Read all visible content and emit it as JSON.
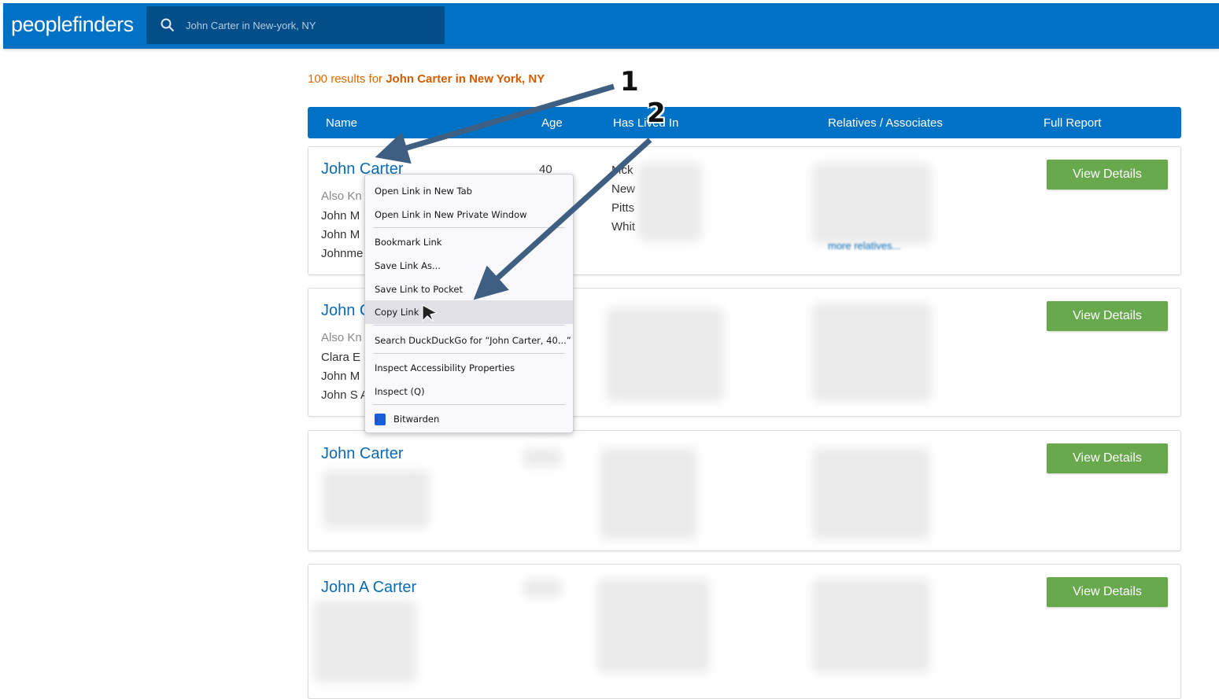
{
  "header": {
    "logo": "peoplefinders",
    "search_value": "John Carter in New-york, NY"
  },
  "summary": {
    "prefix": "100 results for ",
    "query": "John Carter in New York, NY"
  },
  "table_header": {
    "name": "Name",
    "age": "Age",
    "lived": "Has Lived In",
    "relatives": "Relatives / Associates",
    "report": "Full Report"
  },
  "results": [
    {
      "name": "John Carter",
      "age": "40",
      "aka_label": "Also Kn",
      "aka": [
        "John M",
        "John M",
        "Johnme"
      ],
      "places": [
        "Mck",
        "New",
        "Pitts",
        "Whit"
      ],
      "more_relatives": "more relatives...",
      "button": "View Details"
    },
    {
      "name": "John C",
      "aka_label": "Also Kn",
      "aka": [
        "Clara E S",
        "John M",
        "John S A"
      ],
      "button": "View Details"
    },
    {
      "name": "John Carter",
      "button": "View Details"
    },
    {
      "name": "John A Carter",
      "button": "View Details"
    }
  ],
  "context_menu": {
    "items": [
      "Open Link in New Tab",
      "Open Link in New Private Window",
      "Bookmark Link",
      "Save Link As...",
      "Save Link to Pocket",
      "Copy Link",
      "Search DuckDuckGo for “John Carter, 40...”",
      "Inspect Accessibility Properties",
      "Inspect (Q)",
      "Bitwarden"
    ],
    "highlighted": "Copy Link"
  },
  "annotations": {
    "step1": "1",
    "step2": "2"
  },
  "colors": {
    "brand_blue": "#0072c6",
    "search_bg": "#034d89",
    "button_green": "#67a94c",
    "summary_orange": "#e06a00",
    "arrow": "#3f5f82"
  }
}
